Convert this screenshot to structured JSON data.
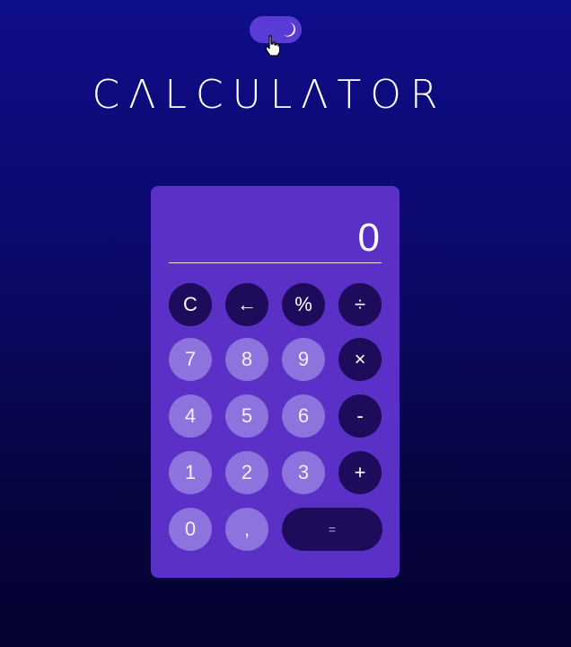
{
  "header": {
    "title": "CΛLCULΛTOR"
  },
  "theme_toggle": {
    "icon": "moon-icon",
    "mode": "dark"
  },
  "display": {
    "value": "0"
  },
  "keys": {
    "clear": "C",
    "backspace": "←",
    "percent": "%",
    "divide": "÷",
    "seven": "7",
    "eight": "8",
    "nine": "9",
    "multiply": "×",
    "four": "4",
    "five": "5",
    "six": "6",
    "subtract": "-",
    "one": "1",
    "two": "2",
    "three": "3",
    "add": "+",
    "zero": "0",
    "decimal": ",",
    "equals": "="
  },
  "colors": {
    "panel": "#5b30c7",
    "operator_key": "#1d0b5c",
    "number_key": "#8c73de",
    "toggle": "#5b3bd6"
  }
}
